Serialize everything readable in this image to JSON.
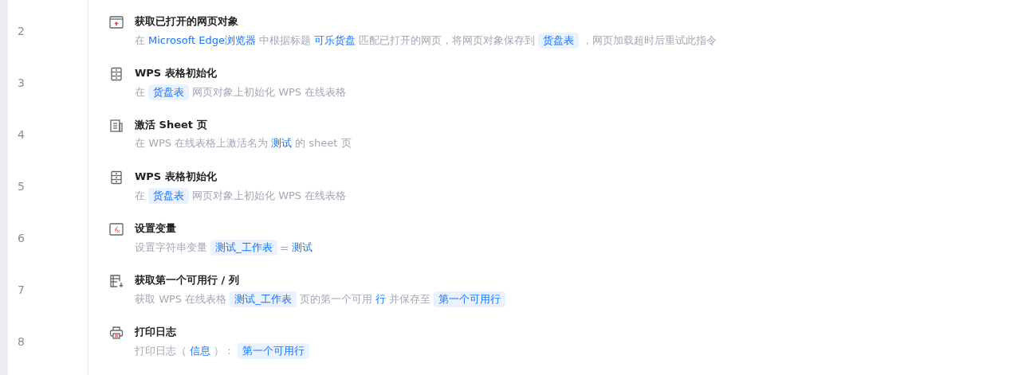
{
  "steps": [
    {
      "number": "2",
      "kind": "browser",
      "title": "获取已打开的网页对象",
      "parts": [
        {
          "kind": "text",
          "text": "在"
        },
        {
          "kind": "value",
          "text": "Microsoft Edge浏览器"
        },
        {
          "kind": "text",
          "text": "中根据标题"
        },
        {
          "kind": "value",
          "text": "可乐货盘"
        },
        {
          "kind": "text",
          "text": "匹配已打开的网页，将网页对象保存到"
        },
        {
          "kind": "chip",
          "text": "货盘表"
        },
        {
          "kind": "text",
          "text": "，网页加载超时后重试此指令"
        }
      ]
    },
    {
      "number": "3",
      "kind": "table",
      "title": "WPS 表格初始化",
      "parts": [
        {
          "kind": "text",
          "text": "在"
        },
        {
          "kind": "chip",
          "text": "货盘表"
        },
        {
          "kind": "text",
          "text": "网页对象上初始化 WPS 在线表格"
        }
      ]
    },
    {
      "number": "4",
      "kind": "sheet",
      "title": "激活 Sheet 页",
      "parts": [
        {
          "kind": "text",
          "text": "在 WPS 在线表格上激活名为"
        },
        {
          "kind": "value",
          "text": "测试"
        },
        {
          "kind": "text",
          "text": "的 sheet 页"
        }
      ]
    },
    {
      "number": "5",
      "kind": "table",
      "title": "WPS 表格初始化",
      "parts": [
        {
          "kind": "text",
          "text": "在"
        },
        {
          "kind": "chip",
          "text": "货盘表"
        },
        {
          "kind": "text",
          "text": "网页对象上初始化 WPS 在线表格"
        }
      ]
    },
    {
      "number": "6",
      "kind": "variable",
      "title": "设置变量",
      "parts": [
        {
          "kind": "text",
          "text": "设置字符串变量"
        },
        {
          "kind": "chip",
          "text": "测试_工作表"
        },
        {
          "kind": "text",
          "text": "="
        },
        {
          "kind": "value",
          "text": "测试"
        }
      ]
    },
    {
      "number": "7",
      "kind": "rows",
      "title": "获取第一个可用行 / 列",
      "parts": [
        {
          "kind": "text",
          "text": "获取 WPS 在线表格"
        },
        {
          "kind": "chip",
          "text": "测试_工作表"
        },
        {
          "kind": "text",
          "text": "页的第一个可用"
        },
        {
          "kind": "value",
          "text": "行"
        },
        {
          "kind": "text",
          "text": "并保存至"
        },
        {
          "kind": "chip",
          "text": "第一个可用行"
        }
      ]
    },
    {
      "number": "8",
      "kind": "printer",
      "title": "打印日志",
      "parts": [
        {
          "kind": "text",
          "text": "打印日志（"
        },
        {
          "kind": "value",
          "text": "信息"
        },
        {
          "kind": "text",
          "text": "）："
        },
        {
          "kind": "chip",
          "text": "第一个可用行"
        }
      ]
    }
  ]
}
